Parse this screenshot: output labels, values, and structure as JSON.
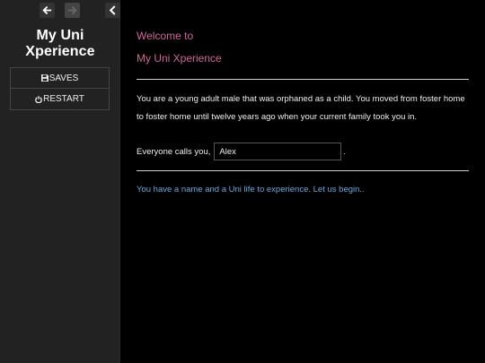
{
  "sidebar": {
    "nav": {
      "back_icon": "arrow-left-icon",
      "forward_icon": "arrow-right-icon",
      "collapse_icon": "chevron-left-icon"
    },
    "story_title": "My Uni Xperience",
    "menu": {
      "saves": {
        "label": "SAVES",
        "icon": "save-icon"
      },
      "restart": {
        "label": "RESTART",
        "icon": "power-icon"
      }
    }
  },
  "passage": {
    "welcome_line1": "Welcome to",
    "welcome_line2": "My Uni Xperience",
    "intro": "You are a young adult male that was orphaned as a child. You moved from foster home to foster home until twelve years ago when your current family took you in.",
    "name_prompt": "Everyone calls you,",
    "name_value": "Alex",
    "name_suffix": ".",
    "begin_link": "You have a name and a Uni life to experience. Let us begin.."
  },
  "colors": {
    "background": "#000000",
    "sidebar": "#222222",
    "accent_pink": "#d2669a",
    "link_blue": "#68a9e0",
    "text": "#eeeeee"
  }
}
